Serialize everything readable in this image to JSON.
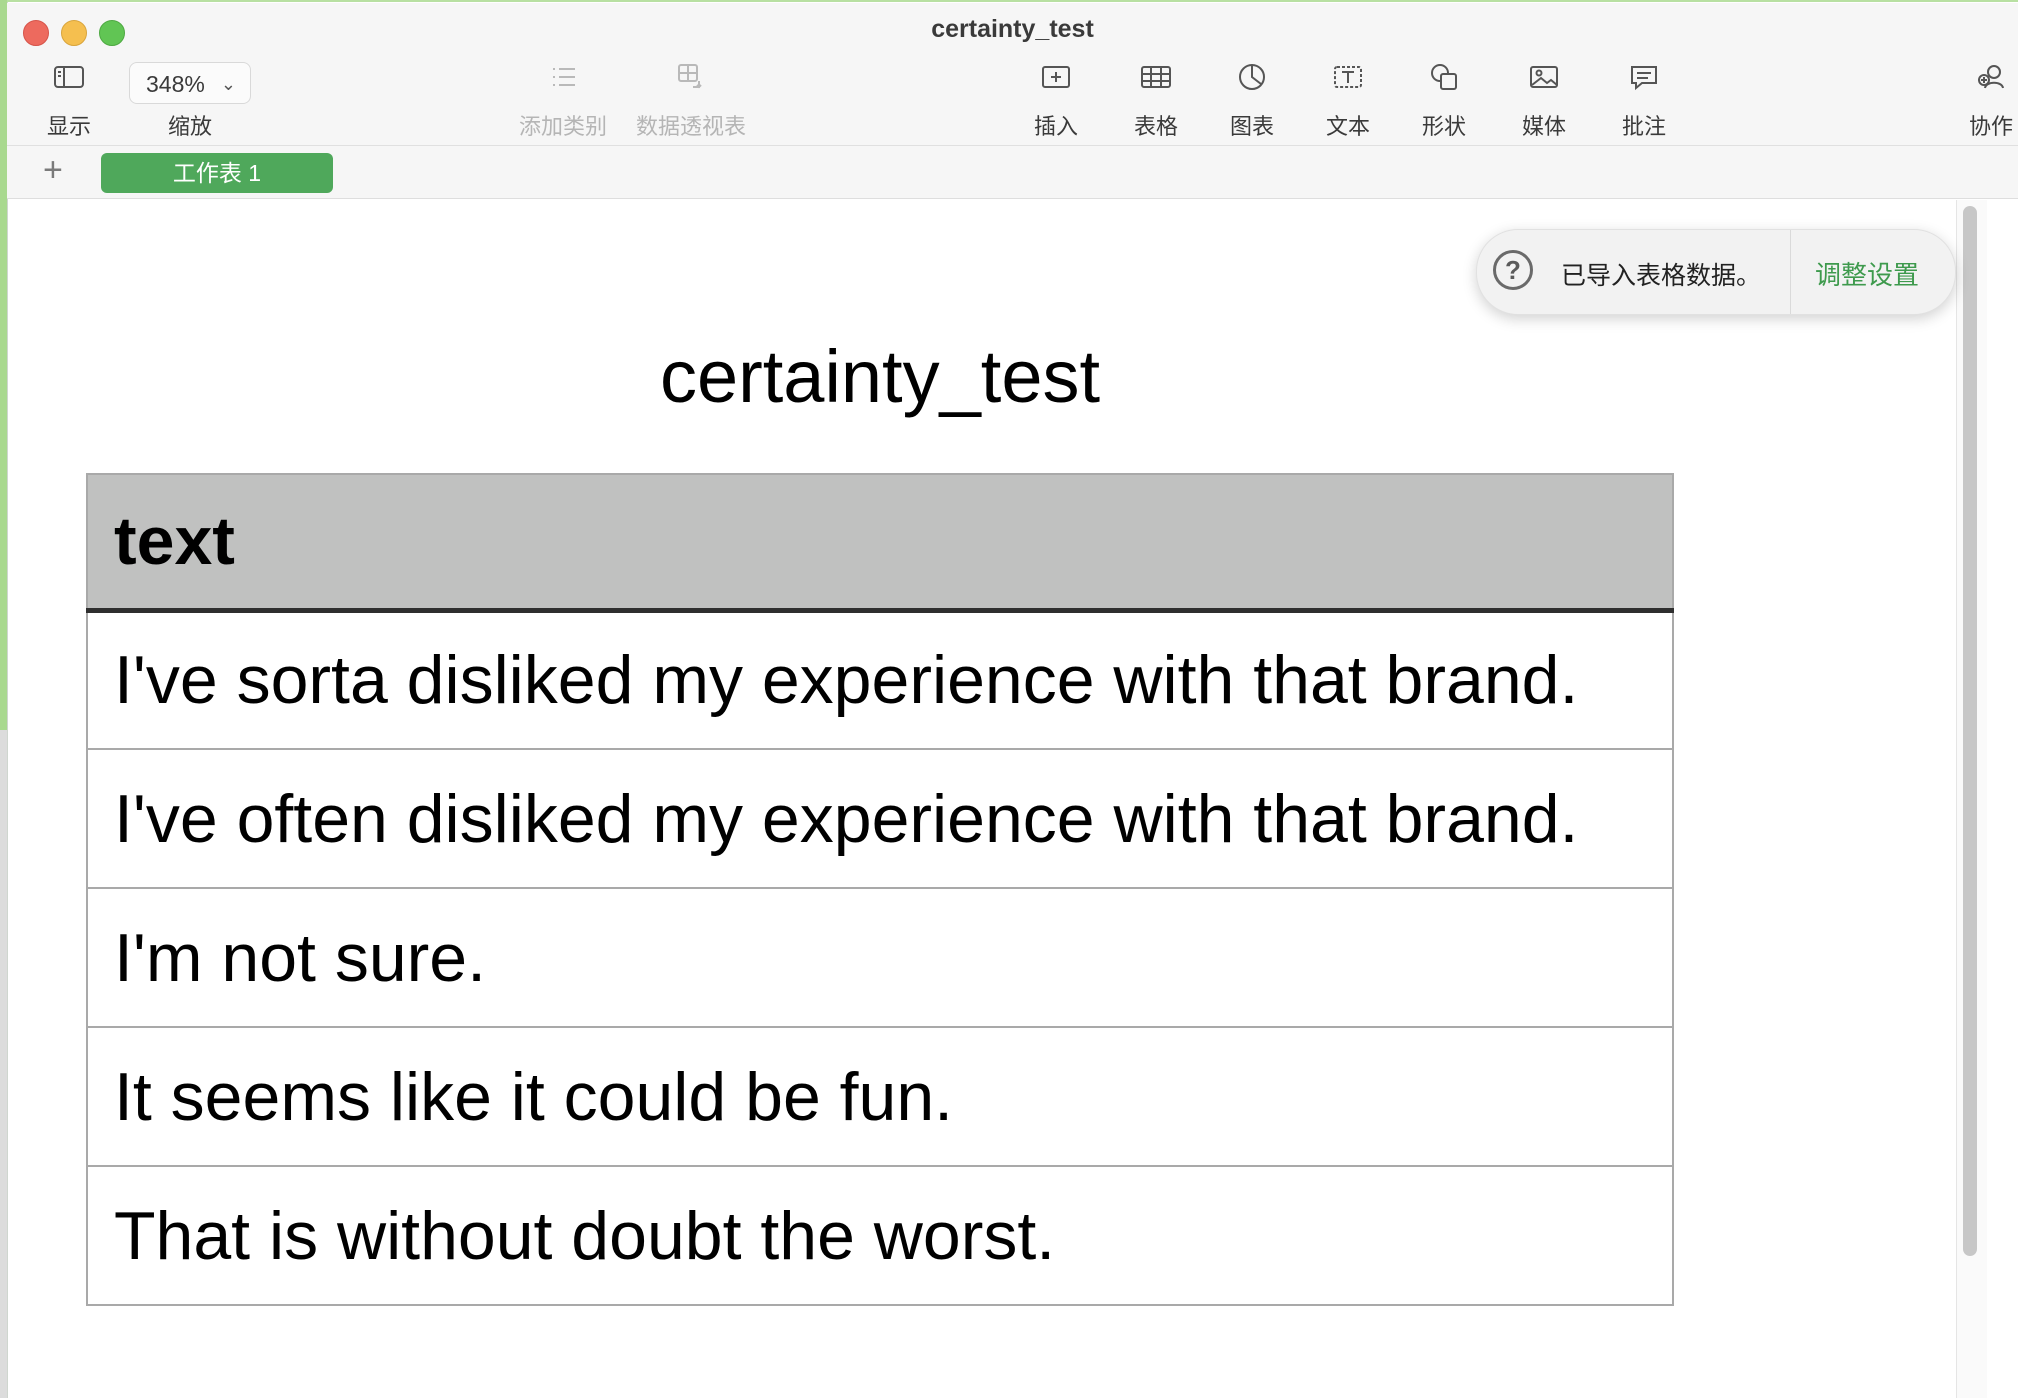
{
  "window": {
    "title": "certainty_test"
  },
  "toolbar": {
    "display_label": "显示",
    "zoom_value": "348%",
    "zoom_label": "缩放",
    "add_category_label": "添加类别",
    "pivot_label": "数据透视表",
    "insert_label": "插入",
    "table_label": "表格",
    "chart_label": "图表",
    "text_label": "文本",
    "shape_label": "形状",
    "media_label": "媒体",
    "comment_label": "批注",
    "collaborate_label": "协作"
  },
  "sheets": {
    "add_glyph": "+",
    "active_tab": "工作表 1"
  },
  "notification": {
    "message": "已导入表格数据。",
    "action": "调整设置"
  },
  "document": {
    "title": "certainty_test",
    "table": {
      "header": "text",
      "rows": [
        "I've sorta disliked my experience with that brand.",
        "I've often disliked my experience with that brand.",
        "I'm not sure.",
        "It seems like it could be fun.",
        "That is without doubt the worst."
      ]
    }
  }
}
